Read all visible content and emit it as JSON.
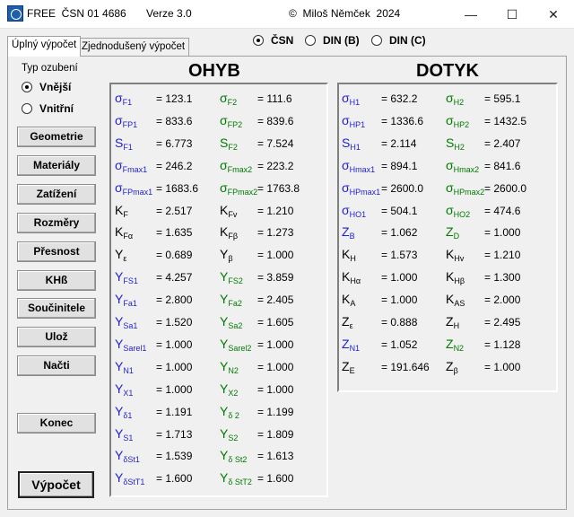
{
  "window": {
    "title": "FREE  ČSN 01 4686",
    "version": "Verze 3.0",
    "author": "©  Miloš Němček  2024",
    "controls": {
      "minimize": "—",
      "maximize": "☐",
      "close": "✕"
    }
  },
  "tabs": [
    "Úplný výpočet",
    "Zjednodušený výpočet"
  ],
  "norms": [
    {
      "label": "ČSN",
      "selected": true
    },
    {
      "label": "DIN (B)",
      "selected": false
    },
    {
      "label": "DIN (C)",
      "selected": false
    }
  ],
  "toothing": {
    "label": "Typ ozubení",
    "options": [
      {
        "label": "Vnější",
        "selected": true
      },
      {
        "label": "Vnitřní",
        "selected": false
      }
    ]
  },
  "buttons": [
    "Geometrie",
    "Materiály",
    "Zatížení",
    "Rozměry",
    "Přesnost",
    "KHß",
    "Součinitele",
    "Ulož",
    "Načti",
    "Konec",
    "Výpočet"
  ],
  "ohyb": {
    "title": "OHYB",
    "rows": [
      {
        "l": {
          "s": "σ",
          "sub": "F1",
          "c": "blue",
          "v": "= 123.1"
        },
        "r": {
          "s": "σ",
          "sub": "F2",
          "c": "green",
          "v": "= 111.6"
        }
      },
      {
        "l": {
          "s": "σ",
          "sub": "FP1",
          "c": "blue",
          "v": "= 833.6"
        },
        "r": {
          "s": "σ",
          "sub": "FP2",
          "c": "green",
          "v": "= 839.6"
        }
      },
      {
        "l": {
          "s": "S",
          "sub": "F1",
          "c": "blue",
          "v": "= 6.773"
        },
        "r": {
          "s": "S",
          "sub": "F2",
          "c": "green",
          "v": "= 7.524"
        }
      },
      {
        "l": {
          "s": "σ",
          "sub": "Fmax1",
          "c": "blue",
          "v": "= 246.2"
        },
        "r": {
          "s": "σ",
          "sub": "Fmax2",
          "c": "green",
          "v": "= 223.2"
        }
      },
      {
        "l": {
          "s": "σ",
          "sub": "FPmax1",
          "c": "blue",
          "v": "= 1683.6"
        },
        "r": {
          "s": "σ",
          "sub": "FPmax2",
          "c": "green",
          "v": "= 1763.8"
        }
      },
      {
        "l": {
          "s": "K",
          "sub": "F",
          "c": "black",
          "v": "= 2.517"
        },
        "r": {
          "s": "K",
          "sub": "Fv",
          "c": "black",
          "v": "= 1.210"
        }
      },
      {
        "l": {
          "s": "K",
          "sub": "Fα",
          "c": "black",
          "v": "= 1.635"
        },
        "r": {
          "s": "K",
          "sub": "Fβ",
          "c": "black",
          "v": "= 1.273"
        }
      },
      {
        "l": {
          "s": "Y",
          "sub": "ε",
          "c": "black",
          "v": "= 0.689"
        },
        "r": {
          "s": "Y",
          "sub": "β",
          "c": "black",
          "v": "= 1.000"
        }
      },
      {
        "l": {
          "s": "Y",
          "sub": "FS1",
          "c": "blue",
          "v": "= 4.257"
        },
        "r": {
          "s": "Y",
          "sub": "FS2",
          "c": "green",
          "v": "= 3.859"
        }
      },
      {
        "l": {
          "s": "Y",
          "sub": "Fa1",
          "c": "blue",
          "v": "= 2.800"
        },
        "r": {
          "s": "Y",
          "sub": "Fa2",
          "c": "green",
          "v": "= 2.405"
        }
      },
      {
        "l": {
          "s": "Y",
          "sub": "Sa1",
          "c": "blue",
          "v": "= 1.520"
        },
        "r": {
          "s": "Y",
          "sub": "Sa2",
          "c": "green",
          "v": "= 1.605"
        }
      },
      {
        "l": {
          "s": "Y",
          "sub": "Sarel1",
          "c": "blue",
          "v": "= 1.000"
        },
        "r": {
          "s": "Y",
          "sub": "Sarel2",
          "c": "green",
          "v": "= 1.000"
        }
      },
      {
        "l": {
          "s": "Y",
          "sub": "N1",
          "c": "blue",
          "v": "= 1.000"
        },
        "r": {
          "s": "Y",
          "sub": "N2",
          "c": "green",
          "v": "= 1.000"
        }
      },
      {
        "l": {
          "s": "Y",
          "sub": "X1",
          "c": "blue",
          "v": "= 1.000"
        },
        "r": {
          "s": "Y",
          "sub": "X2",
          "c": "green",
          "v": "= 1.000"
        }
      },
      {
        "l": {
          "s": "Y",
          "sub": "δ1",
          "c": "blue",
          "v": "= 1.191"
        },
        "r": {
          "s": "Y",
          "sub": "δ 2",
          "c": "green",
          "v": "= 1.199"
        }
      },
      {
        "l": {
          "s": "Y",
          "sub": "S1",
          "c": "blue",
          "v": "= 1.713"
        },
        "r": {
          "s": "Y",
          "sub": "S2",
          "c": "green",
          "v": "= 1.809"
        }
      },
      {
        "l": {
          "s": "Y",
          "sub": "δSt1",
          "c": "blue",
          "v": "= 1.539"
        },
        "r": {
          "s": "Y",
          "sub": "δ St2",
          "c": "green",
          "v": "= 1.613"
        }
      },
      {
        "l": {
          "s": "Y",
          "sub": "δStT1",
          "c": "blue",
          "v": "= 1.600"
        },
        "r": {
          "s": "Y",
          "sub": "δ StT2",
          "c": "green",
          "v": "= 1.600"
        }
      }
    ]
  },
  "dotyk": {
    "title": "DOTYK",
    "rows": [
      {
        "l": {
          "s": "σ",
          "sub": "H1",
          "c": "blue",
          "v": "= 632.2"
        },
        "r": {
          "s": "σ",
          "sub": "H2",
          "c": "green",
          "v": "= 595.1"
        }
      },
      {
        "l": {
          "s": "σ",
          "sub": "HP1",
          "c": "blue",
          "v": "= 1336.6"
        },
        "r": {
          "s": "σ",
          "sub": "HP2",
          "c": "green",
          "v": "= 1432.5"
        }
      },
      {
        "l": {
          "s": "S",
          "sub": "H1",
          "c": "blue",
          "v": "= 2.114"
        },
        "r": {
          "s": "S",
          "sub": "H2",
          "c": "green",
          "v": "= 2.407"
        }
      },
      {
        "l": {
          "s": "σ",
          "sub": "Hmax1",
          "c": "blue",
          "v": "= 894.1"
        },
        "r": {
          "s": "σ",
          "sub": "Hmax2",
          "c": "green",
          "v": "= 841.6"
        }
      },
      {
        "l": {
          "s": "σ",
          "sub": "HPmax1",
          "c": "blue",
          "v": "= 2600.0"
        },
        "r": {
          "s": "σ",
          "sub": "HPmax2",
          "c": "green",
          "v": "= 2600.0"
        }
      },
      {
        "l": {
          "s": "σ",
          "sub": "HO1",
          "c": "blue",
          "v": "= 504.1"
        },
        "r": {
          "s": "σ",
          "sub": "HO2",
          "c": "green",
          "v": "= 474.6"
        }
      },
      {
        "l": {
          "s": "Z",
          "sub": "B",
          "c": "blue",
          "v": "= 1.062"
        },
        "r": {
          "s": "Z",
          "sub": "D",
          "c": "green",
          "v": "= 1.000"
        }
      },
      {
        "l": {
          "s": "K",
          "sub": "H",
          "c": "black",
          "v": "= 1.573"
        },
        "r": {
          "s": "K",
          "sub": "Hv",
          "c": "black",
          "v": "= 1.210"
        }
      },
      {
        "l": {
          "s": "K",
          "sub": "Hα",
          "c": "black",
          "v": "= 1.000"
        },
        "r": {
          "s": "K",
          "sub": "Hβ",
          "c": "black",
          "v": "= 1.300"
        }
      },
      {
        "l": {
          "s": "K",
          "sub": "A",
          "c": "black",
          "v": "= 1.000"
        },
        "r": {
          "s": "K",
          "sub": "AS",
          "c": "black",
          "v": "= 2.000"
        }
      },
      {
        "l": {
          "s": "Z",
          "sub": "ε",
          "c": "black",
          "v": "= 0.888"
        },
        "r": {
          "s": "Z",
          "sub": "H",
          "c": "black",
          "v": "= 2.495"
        }
      },
      {
        "l": {
          "s": "Z",
          "sub": "N1",
          "c": "blue",
          "v": "= 1.052"
        },
        "r": {
          "s": "Z",
          "sub": "N2",
          "c": "green",
          "v": "= 1.128"
        }
      },
      {
        "l": {
          "s": "Z",
          "sub": "E",
          "c": "black",
          "v": "= 191.646"
        },
        "r": {
          "s": "Z",
          "sub": "β",
          "c": "black",
          "v": "= 1.000"
        }
      }
    ]
  }
}
